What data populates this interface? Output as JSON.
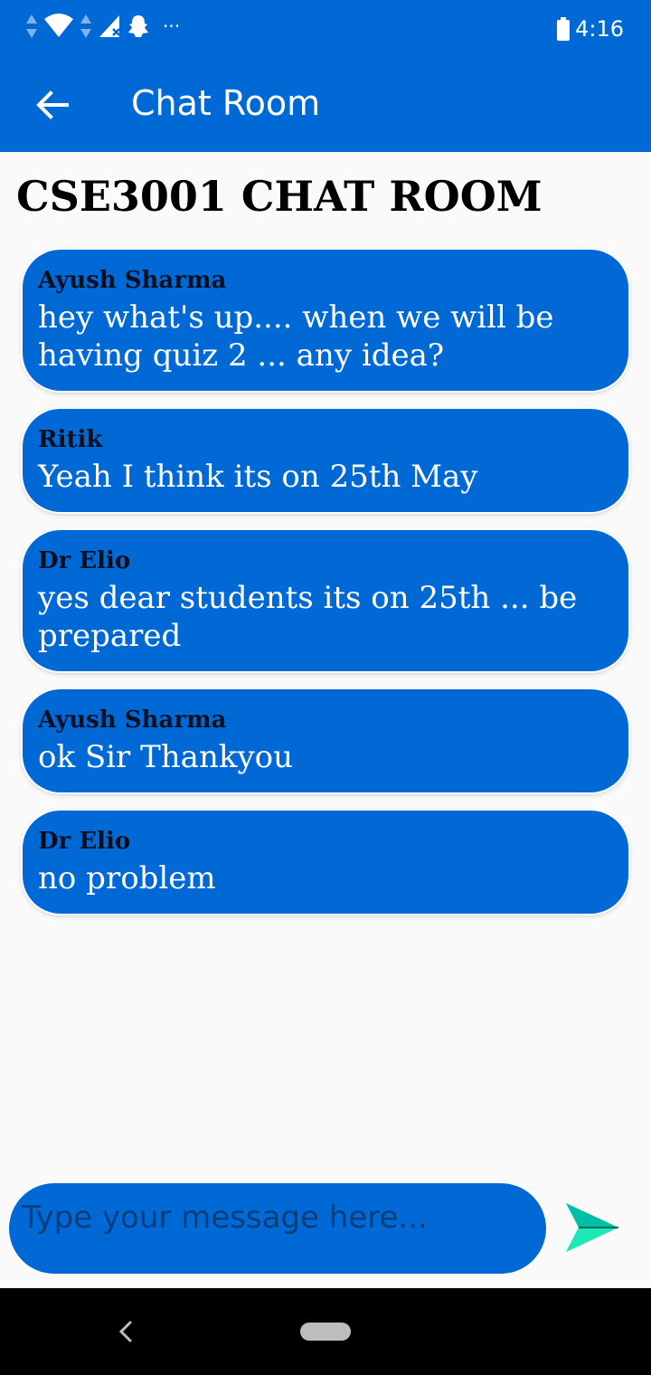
{
  "status_bar": {
    "time": "4:16",
    "icons": [
      "data-arrows-icon",
      "wifi-icon",
      "signal-icon",
      "snapchat-icon",
      "more-dots-icon",
      "battery-icon"
    ],
    "more": "···"
  },
  "app_bar": {
    "title": "Chat Room",
    "back_icon": "arrow-back-icon"
  },
  "room": {
    "title": "CSE3001 CHAT ROOM"
  },
  "messages": [
    {
      "sender": "Ayush Sharma",
      "text": "hey what's up.... when we will be having quiz 2 ... any idea?"
    },
    {
      "sender": "Ritik",
      "text": "Yeah I think its on 25th May"
    },
    {
      "sender": "Dr Elio",
      "text": "yes dear students its on 25th ... be prepared"
    },
    {
      "sender": "Ayush Sharma",
      "text": "ok Sir Thankyou"
    },
    {
      "sender": "Dr Elio",
      "text": "no problem"
    }
  ],
  "composer": {
    "placeholder": "Type your message here...",
    "value": "",
    "send_icon": "send-icon"
  },
  "colors": {
    "primary": "#0069d6",
    "background": "#fafafa",
    "send_icon": "#1de9b6"
  },
  "nav_bar": {
    "icons": [
      "nav-back-icon",
      "nav-home-pill"
    ]
  }
}
